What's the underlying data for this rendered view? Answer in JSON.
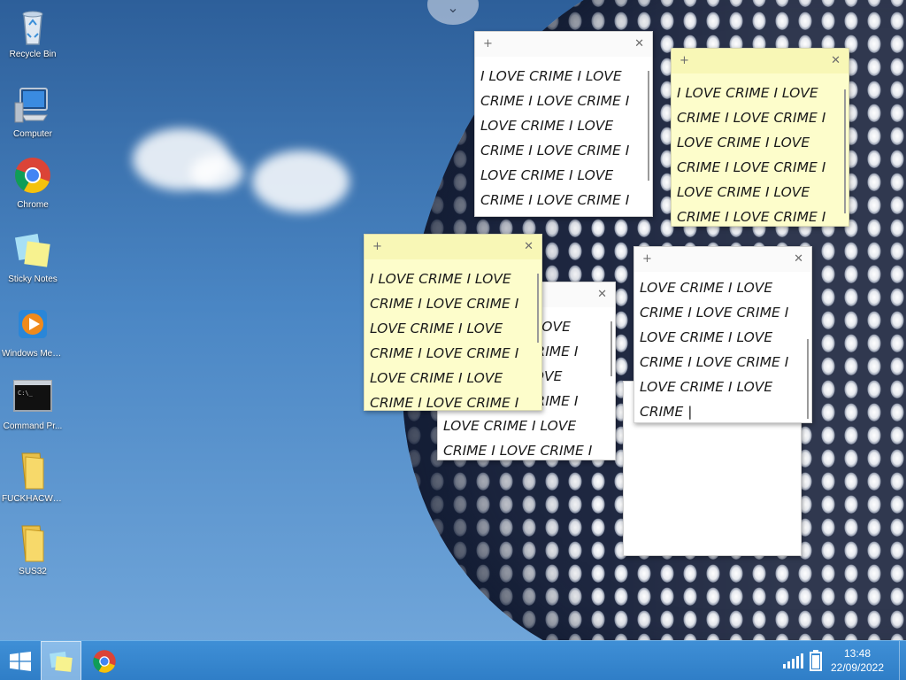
{
  "desktop_icons": [
    {
      "label": "Recycle Bin",
      "icon": "recycle-bin-icon"
    },
    {
      "label": "Computer",
      "icon": "computer-icon"
    },
    {
      "label": "Chrome",
      "icon": "chrome-icon"
    },
    {
      "label": "Sticky Notes",
      "icon": "sticky-notes-icon"
    },
    {
      "label": "Windows Med...",
      "icon": "windows-media-player-icon"
    },
    {
      "label": "Command Pr...",
      "icon": "command-prompt-icon"
    },
    {
      "label": "FUCKHACWI8.1",
      "icon": "folder-icon"
    },
    {
      "label": "SUS32",
      "icon": "folder-icon"
    }
  ],
  "notes": {
    "note1": {
      "text": "I LOVE CRIME I LOVE\nCRIME I LOVE CRIME I\nLOVE CRIME I LOVE\nCRIME I LOVE CRIME I\nLOVE CRIME I LOVE\nCRIME I LOVE CRIME I"
    },
    "note2": {
      "text": "I LOVE CRIME I LOVE\nCRIME I LOVE CRIME I\nLOVE CRIME I LOVE\nCRIME I LOVE CRIME I\nLOVE CRIME I LOVE\nCRIME I LOVE CRIME I"
    },
    "note3": {
      "text": "I LOVE CRIME I LOVE\nCRIME I LOVE CRIME I\nLOVE CRIME I LOVE\nCRIME I LOVE CRIME I\nLOVE CRIME I LOVE\nCRIME I LOVE CRIME I"
    },
    "note4": {
      "text": "                   I LOVE\n                   CRIME I\n                   LOVE\n                   CRIME I\nLOVE CRIME I LOVE\nCRIME I LOVE CRIME I"
    },
    "note5": {
      "text": "LOVE CRIME I LOVE\nCRIME I LOVE CRIME I\nLOVE CRIME I LOVE\nCRIME I LOVE CRIME I\nLOVE CRIME I LOVE\nCRIME |"
    },
    "note6": {
      "text": ""
    }
  },
  "taskbar": {
    "time": "13:48",
    "date": "22/09/2022"
  },
  "colors": {
    "taskbar": "#2f7ec7",
    "note_yellow": "#fdfdcb",
    "note_bar_yellow": "#f8f7b6",
    "note_white": "#ffffff"
  }
}
